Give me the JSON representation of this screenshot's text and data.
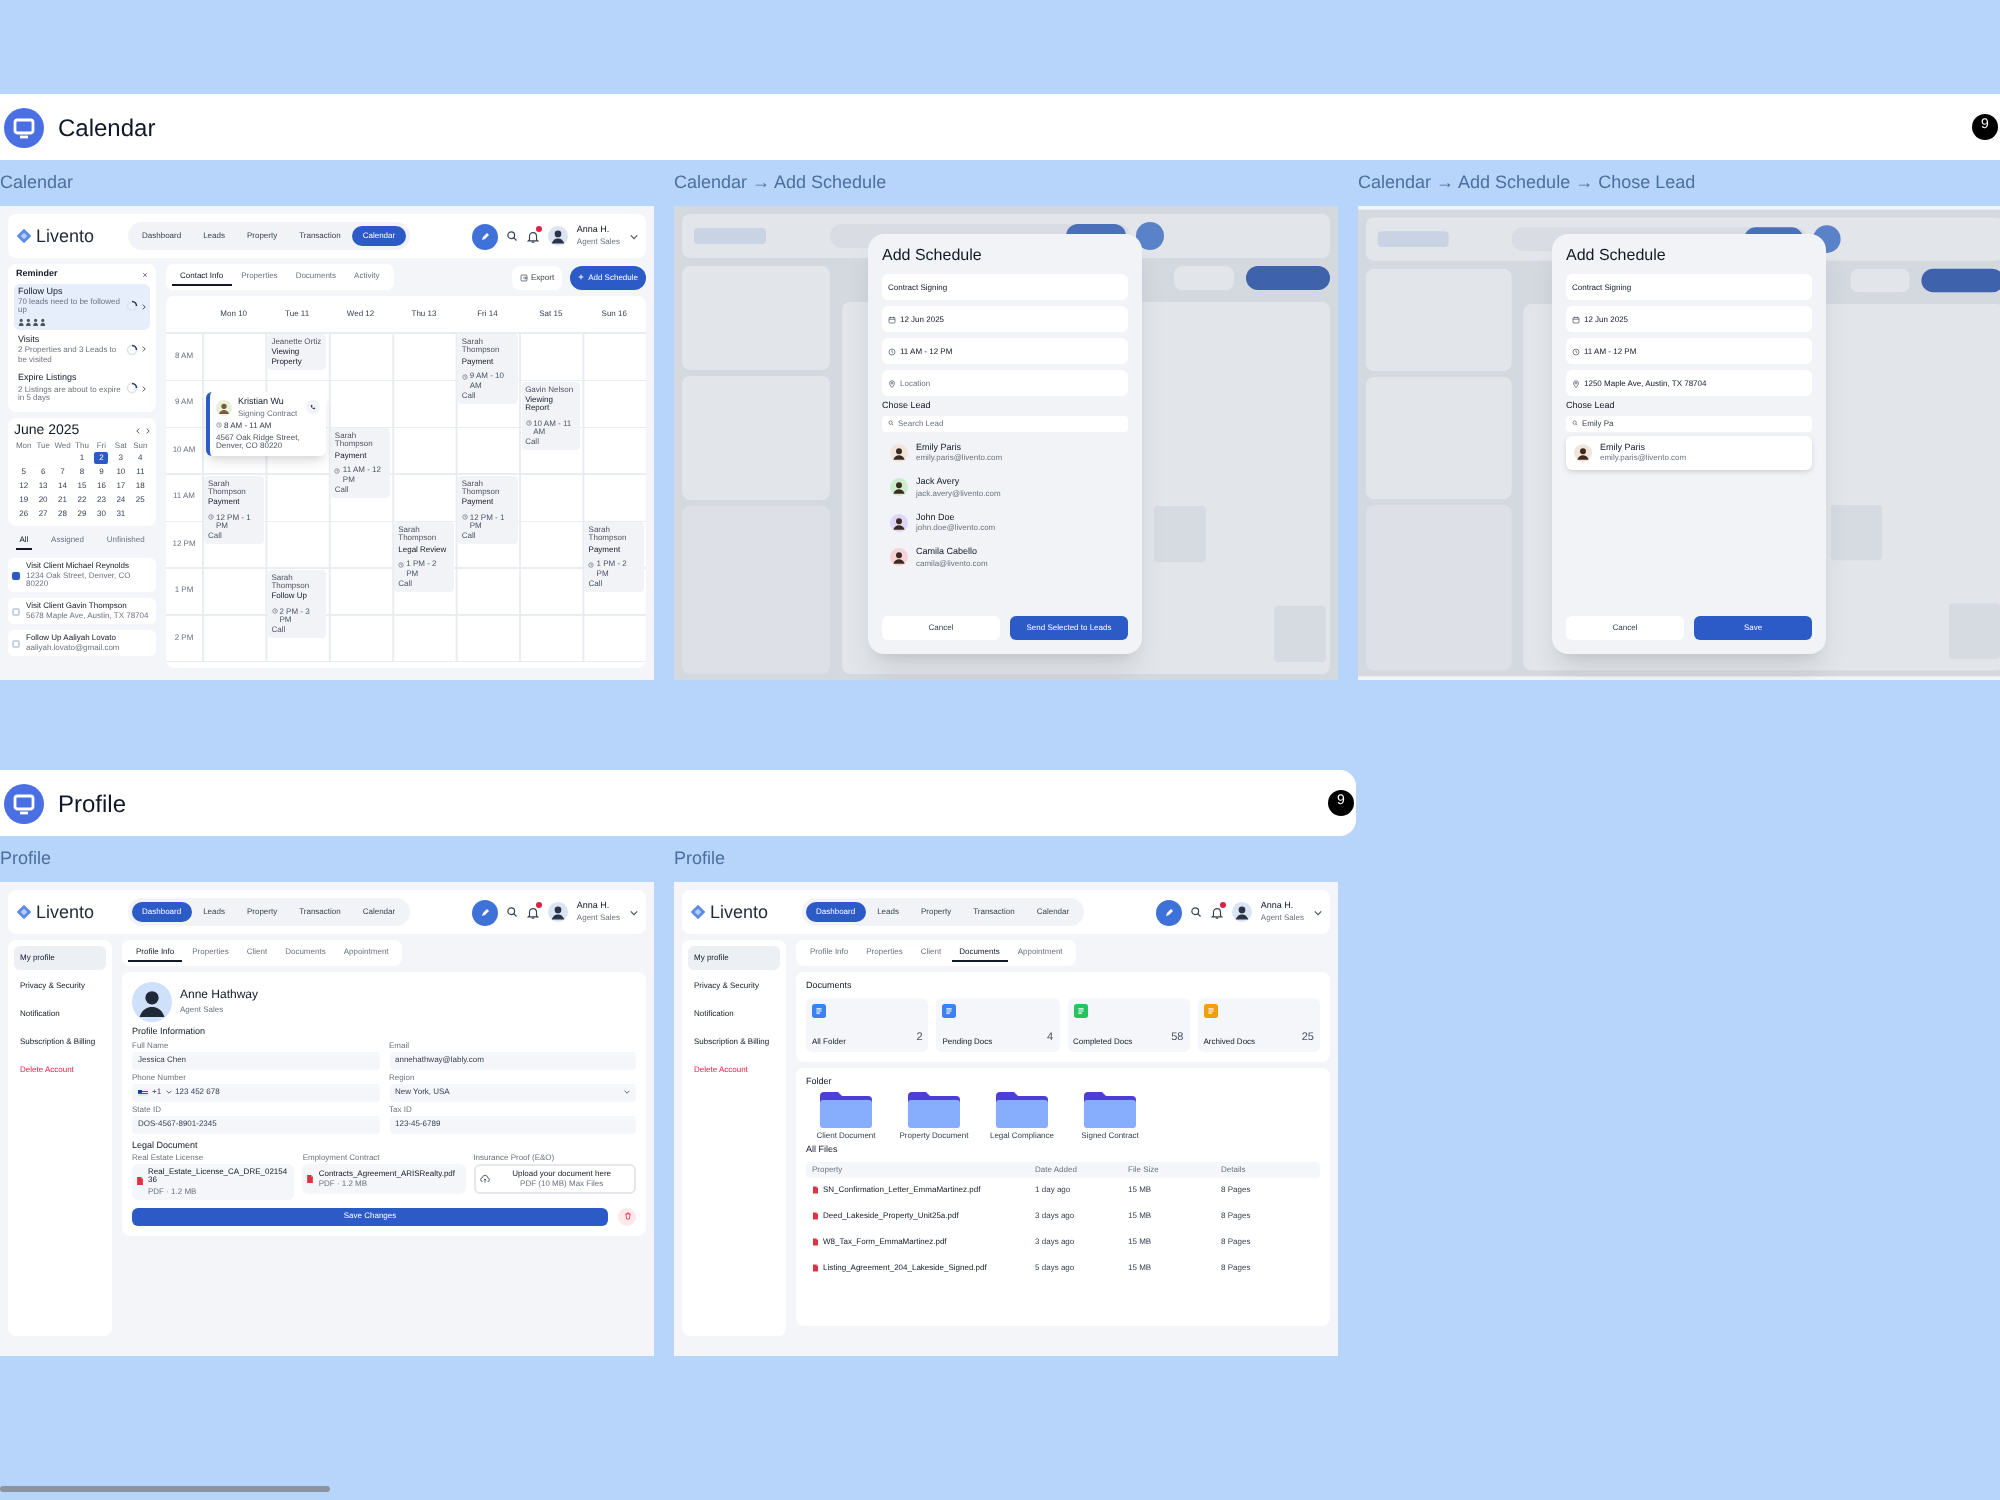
{
  "sections": [
    {
      "title": "Calendar",
      "count": "9",
      "frames": [
        {
          "kind": "calendar",
          "caption": "Calendar",
          "header": {
            "logo": "Livento",
            "nav": [
              {
                "label": "Dashboard",
                "selected": false
              },
              {
                "label": "Leads",
                "selected": false
              },
              {
                "label": "Property",
                "selected": false
              },
              {
                "label": "Transaction",
                "selected": false
              },
              {
                "label": "Calendar",
                "selected": true
              }
            ],
            "user": "Anna H.",
            "role": "Agent Sales"
          },
          "reminder": {
            "title": "Reminder",
            "items": [
              {
                "title": "Follow Ups",
                "subtitle": "70 leads need to be followed up",
                "selected": true,
                "kind": "with_avatars"
              },
              {
                "title": "Visits",
                "subtitle": "2 Properties and 3 Leads to be visited",
                "selected": false,
                "kind": "plain"
              },
              {
                "title": "Expire Listings",
                "subtitle": "2 Listings are about to expire in 5 days",
                "selected": false,
                "kind": "plain"
              }
            ]
          },
          "month": {
            "title": "June 2025",
            "weekdays": [
              "Mon",
              "Tue",
              "Wed",
              "Thu",
              "Fri",
              "Sat",
              "Sun"
            ],
            "weeks": [
              [
                {
                  "day": "1",
                  "selected": false
                },
                {
                  "day": "2",
                  "selected": true
                },
                {
                  "day": "3",
                  "selected": false
                },
                {
                  "day": "4",
                  "selected": false
                }
              ],
              [
                {
                  "day": "5",
                  "selected": false
                },
                {
                  "day": "6",
                  "selected": false
                },
                {
                  "day": "7",
                  "selected": false
                },
                {
                  "day": "8",
                  "selected": false
                },
                {
                  "day": "9",
                  "selected": false
                },
                {
                  "day": "10",
                  "selected": false
                },
                {
                  "day": "11",
                  "selected": false
                }
              ],
              [
                {
                  "day": "12",
                  "selected": false
                },
                {
                  "day": "13",
                  "selected": false
                },
                {
                  "day": "14",
                  "selected": false
                },
                {
                  "day": "15",
                  "selected": false
                },
                {
                  "day": "16",
                  "selected": false
                },
                {
                  "day": "17",
                  "selected": false
                },
                {
                  "day": "18",
                  "selected": false
                }
              ],
              [
                {
                  "day": "19",
                  "selected": false
                },
                {
                  "day": "20",
                  "selected": false
                },
                {
                  "day": "21",
                  "selected": false
                },
                {
                  "day": "22",
                  "selected": false
                },
                {
                  "day": "23",
                  "selected": false
                },
                {
                  "day": "24",
                  "selected": false
                },
                {
                  "day": "25",
                  "selected": false
                }
              ],
              [
                {
                  "day": "26",
                  "selected": false
                },
                {
                  "day": "27",
                  "selected": false
                },
                {
                  "day": "28",
                  "selected": false
                },
                {
                  "day": "29",
                  "selected": false
                },
                {
                  "day": "30",
                  "selected": false
                },
                {
                  "day": "31",
                  "selected": false
                }
              ]
            ]
          },
          "task_tabs": [
            {
              "label": "All",
              "selected": true
            },
            {
              "label": "Assigned",
              "selected": false
            },
            {
              "label": "Unfinished",
              "selected": false
            }
          ],
          "tasks": [
            {
              "title": "Visit Client Michael Reynolds",
              "subtitle": "1234 Oak Street, Denver, CO 80220",
              "checked": true
            },
            {
              "title": "Visit Client Gavin Thompson",
              "subtitle": "5678 Maple Ave, Austin, TX 78704",
              "checked": false
            },
            {
              "title": "Follow Up Aaliyah Lovato",
              "subtitle": "aaliyah.lovato@gmail.com",
              "checked": false
            }
          ],
          "view_tabs": [
            {
              "label": "Contact Info",
              "selected": true
            },
            {
              "label": "Properties",
              "selected": false
            },
            {
              "label": "Documents",
              "selected": false
            },
            {
              "label": "Activity",
              "selected": false
            }
          ],
          "actions": [
            {
              "label": "Export",
              "primary": false
            },
            {
              "label": "Add Schedule",
              "primary": true
            }
          ],
          "days": [
            "Mon 10",
            "Tue 11",
            "Wed 12",
            "Thu 13",
            "Fri 14",
            "Sat 15",
            "Sun 16"
          ],
          "rows": [
            {
              "time": "8 AM",
              "cells": [
                {
                  "kind": "empty"
                },
                {
                  "kind": "event",
                  "title": "Jeanette Ortiz",
                  "subtitle": "Viewing Property"
                },
                {
                  "kind": "empty"
                },
                {
                  "kind": "empty"
                },
                {
                  "kind": "event",
                  "title": "Sarah Thompson",
                  "subtitle": "Payment",
                  "time": "9 AM - 10 AM",
                  "note": "Call"
                },
                {
                  "kind": "empty"
                },
                {
                  "kind": "empty"
                }
              ]
            },
            {
              "time": "9 AM",
              "cells": [
                {
                  "kind": "empty"
                },
                {
                  "kind": "empty"
                },
                {
                  "kind": "empty"
                },
                {
                  "kind": "empty"
                },
                {
                  "kind": "empty"
                },
                {
                  "kind": "event",
                  "title": "Gavin Nelson",
                  "subtitle": "Viewing Report",
                  "time": "10 AM - 11 AM",
                  "note": "Call"
                },
                {
                  "kind": "empty"
                }
              ]
            },
            {
              "time": "10 AM",
              "cells": [
                {
                  "kind": "empty"
                },
                {
                  "kind": "empty"
                },
                {
                  "kind": "event",
                  "title": "Sarah Thompson",
                  "subtitle": "Payment",
                  "time": "11 AM - 12 PM",
                  "note": "Call"
                },
                {
                  "kind": "empty"
                },
                {
                  "kind": "empty"
                },
                {
                  "kind": "empty"
                },
                {
                  "kind": "empty"
                }
              ]
            },
            {
              "time": "11 AM",
              "cells": [
                {
                  "kind": "event",
                  "title": "Sarah Thompson",
                  "subtitle": "Payment",
                  "time": "12 PM - 1 PM",
                  "note": "Call"
                },
                {
                  "kind": "empty"
                },
                {
                  "kind": "empty"
                },
                {
                  "kind": "empty"
                },
                {
                  "kind": "event",
                  "title": "Sarah Thompson",
                  "subtitle": "Payment",
                  "time": "12 PM - 1 PM",
                  "note": "Call"
                },
                {
                  "kind": "empty"
                },
                {
                  "kind": "empty"
                }
              ]
            },
            {
              "time": "12 PM",
              "cells": [
                {
                  "kind": "empty"
                },
                {
                  "kind": "empty"
                },
                {
                  "kind": "empty"
                },
                {
                  "kind": "event",
                  "title": "Sarah Thompson",
                  "subtitle": "Legal Review",
                  "time": "1 PM - 2 PM",
                  "note": "Call"
                },
                {
                  "kind": "empty"
                },
                {
                  "kind": "empty"
                },
                {
                  "kind": "event",
                  "title": "Sarah Thompson",
                  "subtitle": "Payment",
                  "time": "1 PM - 2 PM",
                  "note": "Call"
                }
              ]
            },
            {
              "time": "1 PM",
              "cells": [
                {
                  "kind": "empty"
                },
                {
                  "kind": "event",
                  "title": "Sarah Thompson",
                  "subtitle": "Follow Up",
                  "time": "2 PM - 3 PM",
                  "note": "Call"
                },
                {
                  "kind": "empty"
                },
                {
                  "kind": "empty"
                },
                {
                  "kind": "empty"
                },
                {
                  "kind": "empty"
                },
                {
                  "kind": "empty"
                }
              ]
            },
            {
              "time": "2 PM",
              "cells": [
                {
                  "kind": "empty"
                },
                {
                  "kind": "empty"
                },
                {
                  "kind": "empty"
                },
                {
                  "kind": "empty"
                },
                {
                  "kind": "empty"
                },
                {
                  "kind": "empty"
                },
                {
                  "kind": "empty"
                }
              ]
            }
          ],
          "popup": {
            "name": "Kristian Wu",
            "subtitle": "Signing Contract",
            "time": "8 AM - 11 AM",
            "address": "4567 Oak Ridge Street, Denver, CO 80220"
          }
        },
        {
          "kind": "schedule_modal",
          "caption": "Calendar → Add Schedule",
          "modal": {
            "title": "Add Schedule",
            "fields": [
              {
                "kind": "text",
                "value": "Contract Signing"
              },
              {
                "kind": "date",
                "value": "12 Jun 2025"
              },
              {
                "kind": "time",
                "value": "11 AM - 12 PM"
              },
              {
                "kind": "location",
                "placeholder": "Location"
              }
            ],
            "lead_label": "Chose Lead",
            "search": {
              "placeholder": "Search Lead"
            },
            "leads": [
              {
                "name": "Emily Paris",
                "email": "emily.paris@livento.com",
                "color": "#f1e4da",
                "selected": false
              },
              {
                "name": "Jack Avery",
                "email": "jack.avery@livento.com",
                "color": "#cdeccd",
                "selected": false
              },
              {
                "name": "John Doe",
                "email": "john.doe@livento.com",
                "color": "#ddd6f7",
                "selected": false
              },
              {
                "name": "Camila Cabello",
                "email": "camila@livento.com",
                "color": "#f7d2d6",
                "selected": false
              }
            ],
            "buttons": [
              {
                "label": "Cancel",
                "primary": false
              },
              {
                "label": "Send Selected to Leads",
                "primary": true
              }
            ]
          }
        },
        {
          "kind": "schedule_modal",
          "caption": "Calendar → Add Schedule → Chose Lead",
          "modal": {
            "title": "Add Schedule",
            "fields": [
              {
                "kind": "text",
                "value": "Contract Signing"
              },
              {
                "kind": "date",
                "value": "12 Jun 2025"
              },
              {
                "kind": "time",
                "value": "11 AM - 12 PM"
              },
              {
                "kind": "location",
                "value": "1250 Maple Ave, Austin, TX 78704"
              }
            ],
            "lead_label": "Chose Lead",
            "search": {
              "value": "Emily Pa"
            },
            "leads": [
              {
                "name": "Emily Paris",
                "email": "emily.paris@livento.com",
                "color": "#f1e4da",
                "selected": true
              }
            ],
            "buttons": [
              {
                "label": "Cancel",
                "primary": false
              },
              {
                "label": "Save",
                "primary": true
              }
            ]
          }
        }
      ]
    },
    {
      "title": "Profile",
      "count": "9",
      "frames": [
        {
          "kind": "profile_info",
          "caption": "Profile",
          "header": {
            "logo": "Livento",
            "nav": [
              {
                "label": "Dashboard",
                "selected": true
              },
              {
                "label": "Leads",
                "selected": false
              },
              {
                "label": "Property",
                "selected": false
              },
              {
                "label": "Transaction",
                "selected": false
              },
              {
                "label": "Calendar",
                "selected": false
              }
            ],
            "user": "Anna H.",
            "role": "Agent Sales"
          },
          "menu": [
            {
              "label": "My profile",
              "selected": true,
              "danger": false
            },
            {
              "label": "Privacy & Security",
              "selected": false,
              "danger": false
            },
            {
              "label": "Notification",
              "selected": false,
              "danger": false
            },
            {
              "label": "Subscription & Billing",
              "selected": false,
              "danger": false
            },
            {
              "label": "Delete Account",
              "selected": false,
              "danger": true
            }
          ],
          "tabs": [
            {
              "label": "Profile Info",
              "selected": true
            },
            {
              "label": "Properties",
              "selected": false
            },
            {
              "label": "Client",
              "selected": false
            },
            {
              "label": "Documents",
              "selected": false
            },
            {
              "label": "Appointment",
              "selected": false
            }
          ],
          "profile": {
            "name": "Anne Hathway",
            "role": "Agent Sales"
          },
          "section_title": "Profile Information",
          "fields": [
            {
              "label": "Full Name",
              "kind": "text",
              "value": "Jessica Chen"
            },
            {
              "label": "Email",
              "kind": "text",
              "value": "annehathway@lably.com"
            },
            {
              "label": "Phone Number",
              "kind": "phone",
              "code": "+1",
              "value": "123 452 678"
            },
            {
              "label": "Region",
              "kind": "select",
              "value": "New York, USA"
            },
            {
              "label": "State ID",
              "kind": "text",
              "value": "DOS-4567-8901-2345"
            },
            {
              "label": "Tax ID",
              "kind": "text",
              "value": "123-45-6789"
            }
          ],
          "legal_title": "Legal Document",
          "documents": [
            {
              "label": "Real Estate License",
              "kind": "file",
              "file": "Real_Estate_License_CA_DRE_0215436",
              "meta": "PDF · 1.2 MB"
            },
            {
              "label": "Employment Contract",
              "kind": "file",
              "file": "Contracts_Agreement_ARISRealty.pdf",
              "meta": "PDF · 1.2 MB"
            },
            {
              "label": "Insurance Proof (E&O)",
              "kind": "upload",
              "file": "Upload your document here",
              "meta": "PDF (10 MB) Max Files"
            }
          ],
          "save": "Save Changes"
        },
        {
          "kind": "profile_documents",
          "caption": "Profile",
          "header": {
            "logo": "Livento",
            "nav": [
              {
                "label": "Dashboard",
                "selected": true
              },
              {
                "label": "Leads",
                "selected": false
              },
              {
                "label": "Property",
                "selected": false
              },
              {
                "label": "Transaction",
                "selected": false
              },
              {
                "label": "Calendar",
                "selected": false
              }
            ],
            "user": "Anna H.",
            "role": "Agent Sales"
          },
          "menu": [
            {
              "label": "My profile",
              "selected": true,
              "danger": false
            },
            {
              "label": "Privacy & Security",
              "selected": false,
              "danger": false
            },
            {
              "label": "Notification",
              "selected": false,
              "danger": false
            },
            {
              "label": "Subscription & Billing",
              "selected": false,
              "danger": false
            },
            {
              "label": "Delete Account",
              "selected": false,
              "danger": true
            }
          ],
          "tabs": [
            {
              "label": "Profile Info",
              "selected": false
            },
            {
              "label": "Properties",
              "selected": false
            },
            {
              "label": "Client",
              "selected": false
            },
            {
              "label": "Documents",
              "selected": true
            },
            {
              "label": "Appointment",
              "selected": false
            }
          ],
          "documents_title": "Documents",
          "stats": [
            {
              "label": "All Folder",
              "count": "2",
              "color": "#3b82f6"
            },
            {
              "label": "Pending Docs",
              "count": "4",
              "color": "#3b82f6"
            },
            {
              "label": "Completed Docs",
              "count": "58",
              "color": "#22c55e"
            },
            {
              "label": "Archived Docs",
              "count": "25",
              "color": "#f59e0b"
            }
          ],
          "folder_title": "Folder",
          "folders": [
            "Client Document",
            "Property Document",
            "Legal Compliance",
            "Signed Contract"
          ],
          "files_title": "All Files",
          "columns": [
            "Property",
            "Date Added",
            "File Size",
            "Details"
          ],
          "files": [
            {
              "name": "SN_Confirmation_Letter_EmmaMartinez.pdf",
              "date": "1 day ago",
              "size": "15 MB",
              "details": "8 Pages"
            },
            {
              "name": "Deed_Lakeside_Property_Unit25a.pdf",
              "date": "3 days ago",
              "size": "15 MB",
              "details": "8 Pages"
            },
            {
              "name": "W8_Tax_Form_EmmaMartinez.pdf",
              "date": "3 days ago",
              "size": "15 MB",
              "details": "8 Pages"
            },
            {
              "name": "Listing_Agreement_204_Lakeside_Signed.pdf",
              "date": "5 days ago",
              "size": "15 MB",
              "details": "8 Pages"
            }
          ]
        }
      ]
    }
  ]
}
